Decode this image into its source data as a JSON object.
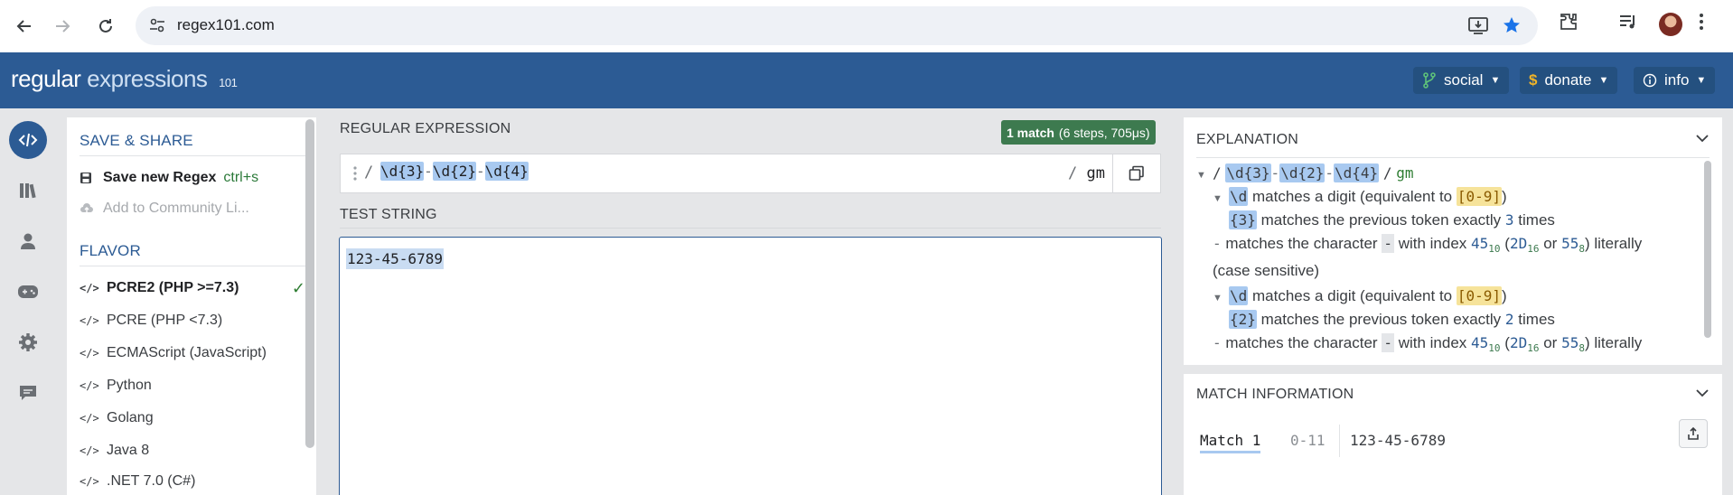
{
  "browser": {
    "url": "regex101.com",
    "icons": [
      "back-arrow-icon",
      "forward-arrow-icon",
      "reload-icon",
      "site-settings-icon",
      "install-app-icon",
      "bookmark-star-icon",
      "extensions-icon",
      "media-controls-icon"
    ],
    "accent_color": "#1a73e8"
  },
  "header": {
    "logo_main": "regular",
    "logo_accent": "expressions",
    "logo_version": "101",
    "social_label": "social",
    "donate_label": "donate",
    "info_label": "info",
    "background_color": "#2c5b94"
  },
  "rail": {
    "items": [
      "code-icon",
      "library-icon",
      "account-icon",
      "quiz-icon",
      "settings-icon",
      "chat-icon"
    ]
  },
  "sidebar": {
    "save_share_title": "SAVE & SHARE",
    "save_label": "Save new Regex",
    "save_shortcut": "ctrl+s",
    "community_label": "Add to Community Li...",
    "flavor_title": "FLAVOR",
    "flavor_selected": "PCRE2 (PHP >=7.3)",
    "flavors": [
      "PCRE2 (PHP >=7.3)",
      "PCRE (PHP <7.3)",
      "ECMAScript (JavaScript)",
      "Python",
      "Golang",
      "Java 8",
      ".NET 7.0 (C#)"
    ],
    "flavor_icon_text": "</>"
  },
  "regex": {
    "section_title": "REGULAR EXPRESSION",
    "match_count": "1 match",
    "match_stats": "(6 steps, 705μs)",
    "delimiter": "/",
    "tok1": "\\d{3}",
    "lit1": "-",
    "tok2": "\\d{2}",
    "lit2": "-",
    "tok3": "\\d{4}",
    "flags_delim": "/",
    "flags": "gm",
    "badge_color": "#3d7a4f"
  },
  "test": {
    "section_title": "TEST STRING",
    "value": "123-45-6789"
  },
  "explanation": {
    "title": "EXPLANATION",
    "root_delim": "/",
    "root_tok1": "\\d{3}",
    "root_lit1": "-",
    "root_tok2": "\\d{2}",
    "root_lit2": "-",
    "root_tok3": "\\d{4}",
    "root_flags_delim": "/",
    "root_flags": "gm",
    "digit_token": "\\d",
    "digit_text": "matches a digit (equivalent to",
    "digit_class": "[0-9]",
    "digit_close": ")",
    "q3_token": "{3}",
    "q_text": "matches the previous token exactly",
    "q3_count": "3",
    "times": "times",
    "dash_prefix": "-",
    "char_text_a": "matches the character",
    "char_token": "-",
    "char_text_b": "with index",
    "index_dec": "45",
    "base10": "10",
    "open_paren": "(",
    "index_hex": "2D",
    "base16": "16",
    "or_text": "or",
    "index_oct": "55",
    "base8": "8",
    "literally": ") literally",
    "case_sensitive": "(case sensitive)",
    "q2_token": "{2}",
    "q2_count": "2"
  },
  "match_info": {
    "title": "MATCH INFORMATION",
    "match_label": "Match 1",
    "range": "0-11",
    "value": "123-45-6789"
  }
}
